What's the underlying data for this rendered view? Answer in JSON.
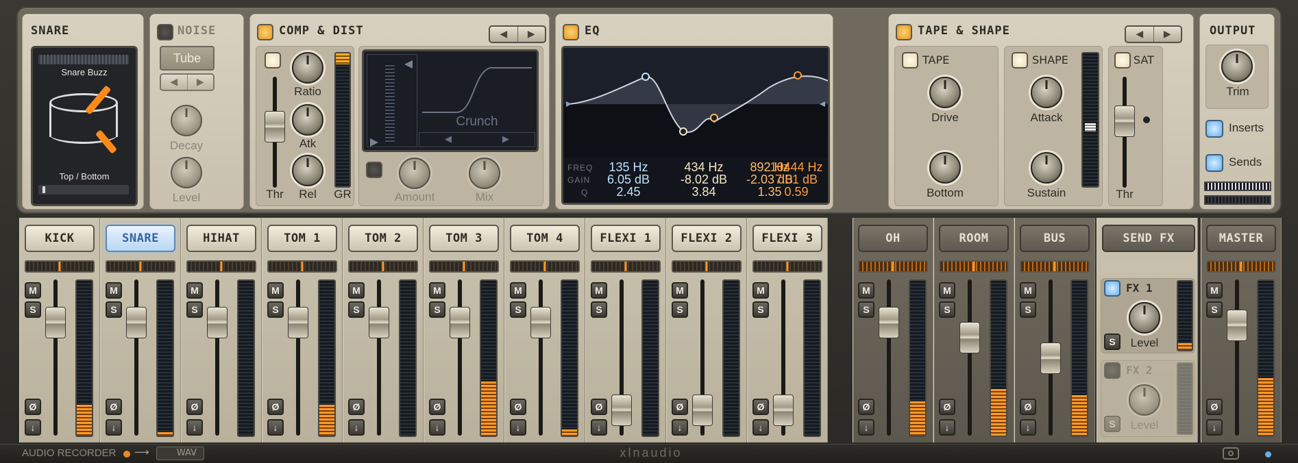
{
  "snare": {
    "title": "SNARE",
    "sample_top": "Snare Buzz",
    "sample_bottom": "Top / Bottom"
  },
  "noise": {
    "title": "NOISE",
    "type": "Tube",
    "decay_label": "Decay",
    "level_label": "Level"
  },
  "comp": {
    "title": "COMP & DIST",
    "ratio": "Ratio",
    "atk": "Atk",
    "rel": "Rel",
    "thr": "Thr",
    "gr": "GR",
    "preset": "Crunch",
    "amount": "Amount",
    "mix": "Mix"
  },
  "eq": {
    "title": "EQ",
    "row_freq": "FREQ",
    "row_gain": "GAIN",
    "row_q": "Q",
    "bands": [
      {
        "freq": "135 Hz",
        "gain": "6.05 dB",
        "q": "2.45",
        "color": "#bfe0ff"
      },
      {
        "freq": "434 Hz",
        "gain": "-8.02 dB",
        "q": "3.84",
        "color": "#f4e6c6"
      },
      {
        "freq": "892 Hz",
        "gain": "-2.03 dB",
        "q": "1.35",
        "color": "#ffb86a"
      },
      {
        "freq": "10444 Hz",
        "gain": "7.01 dB",
        "q": "0.59",
        "color": "#ff9a3a"
      }
    ]
  },
  "tape": {
    "title": "TAPE & SHAPE",
    "tape_label": "TAPE",
    "drive": "Drive",
    "bottom": "Bottom",
    "shape_label": "SHAPE",
    "attack": "Attack",
    "sustain": "Sustain",
    "sat_label": "SAT",
    "thr": "Thr"
  },
  "output": {
    "title": "OUTPUT",
    "trim": "Trim",
    "inserts": "Inserts",
    "sends": "Sends"
  },
  "channels": [
    {
      "name": "KICK",
      "meter": 0.2
    },
    {
      "name": "SNARE",
      "meter": 0.02,
      "selected": true
    },
    {
      "name": "HIHAT",
      "meter": 0
    },
    {
      "name": "TOM 1",
      "meter": 0.2
    },
    {
      "name": "TOM 2",
      "meter": 0
    },
    {
      "name": "TOM 3",
      "meter": 0.35
    },
    {
      "name": "TOM 4",
      "meter": 0.04
    },
    {
      "name": "FLEXI 1",
      "meter": 0
    },
    {
      "name": "FLEXI 2",
      "meter": 0
    },
    {
      "name": "FLEXI 3",
      "meter": 0
    }
  ],
  "busses": [
    {
      "name": "OH",
      "meter": 0.22
    },
    {
      "name": "ROOM",
      "meter": 0.3
    },
    {
      "name": "BUS",
      "meter": 0.26
    }
  ],
  "sendfx": {
    "name": "SEND FX",
    "fx1": "FX 1",
    "fx2": "FX 2",
    "level": "Level"
  },
  "master": {
    "name": "MASTER",
    "meter": 0.37
  },
  "buttons": {
    "m": "M",
    "s": "S",
    "phase": "Ø",
    "arrow": "↓"
  },
  "footer": {
    "recorder": "AUDIO RECORDER",
    "format": "WAV",
    "logo": "xlnaudio"
  }
}
